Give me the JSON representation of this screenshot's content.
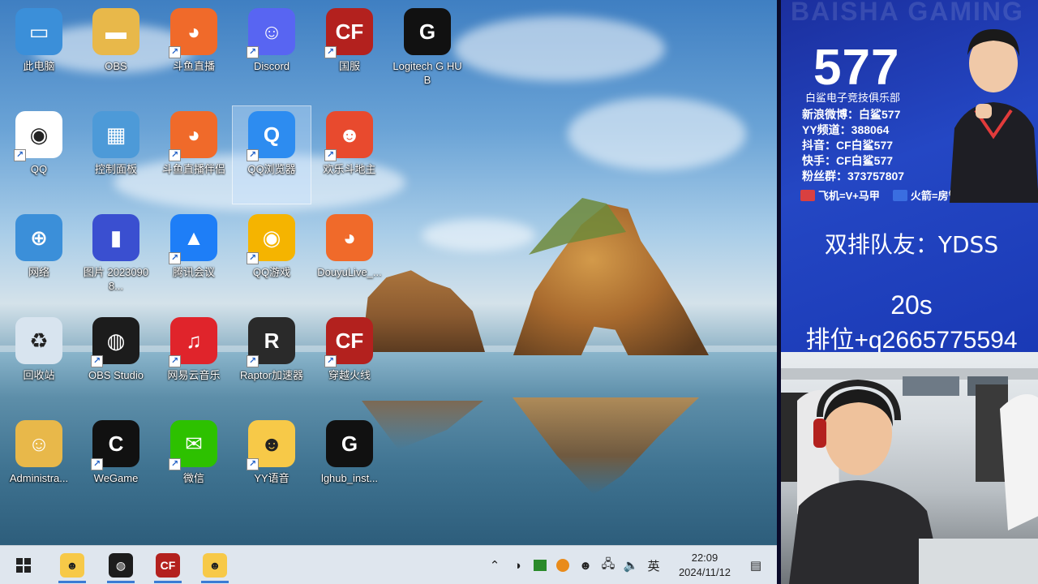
{
  "desktop": {
    "icons": [
      {
        "label": "此电脑",
        "icon": "computer-icon",
        "color": "#3b8fd9",
        "glyph": "▭",
        "shortcut": false
      },
      {
        "label": "OBS",
        "icon": "folder-icon",
        "color": "#e8b84a",
        "glyph": "▬",
        "shortcut": false
      },
      {
        "label": "斗鱼直播",
        "icon": "douyu-icon",
        "color": "#f06a2a",
        "glyph": "◕",
        "shortcut": true
      },
      {
        "label": "Discord",
        "icon": "discord-icon",
        "color": "#5865f2",
        "glyph": "☺",
        "shortcut": true
      },
      {
        "label": "国服",
        "icon": "crossfire-icon",
        "color": "#b3211e",
        "glyph": "CF",
        "shortcut": true
      },
      {
        "label": "Logitech G HUB",
        "icon": "logitech-icon",
        "color": "#111111",
        "glyph": "G",
        "shortcut": false
      },
      {
        "label": "QQ",
        "icon": "qq-icon",
        "color": "#ffffff",
        "glyph": "◉",
        "shortcut": true
      },
      {
        "label": "控制面板",
        "icon": "control-panel-icon",
        "color": "#4d9ad8",
        "glyph": "▦",
        "shortcut": false
      },
      {
        "label": "斗鱼直播伴侣",
        "icon": "douyu-companion-icon",
        "color": "#f06a2a",
        "glyph": "◕",
        "shortcut": true
      },
      {
        "label": "QQ浏览器",
        "icon": "qq-browser-icon",
        "color": "#2d8cf0",
        "glyph": "Q",
        "shortcut": true
      },
      {
        "label": "欢乐斗地主",
        "icon": "landlord-game-icon",
        "color": "#e84a2e",
        "glyph": "☻",
        "shortcut": true
      },
      {
        "label": "网络",
        "icon": "network-icon",
        "color": "#3b8fd9",
        "glyph": "⊕",
        "shortcut": false
      },
      {
        "label": "图片 20230908...",
        "icon": "image-file-icon",
        "color": "#3a4fd0",
        "glyph": "▮",
        "shortcut": false
      },
      {
        "label": "腾讯会议",
        "icon": "tencent-meeting-icon",
        "color": "#1e7ef7",
        "glyph": "▲",
        "shortcut": true
      },
      {
        "label": "QQ游戏",
        "icon": "qq-game-icon",
        "color": "#f5b400",
        "glyph": "◉",
        "shortcut": true
      },
      {
        "label": "DouyuLive_...",
        "icon": "douyu-installer-icon",
        "color": "#f06a2a",
        "glyph": "◕",
        "shortcut": false
      },
      {
        "label": "回收站",
        "icon": "recycle-bin-icon",
        "color": "#d8e4ef",
        "glyph": "♻",
        "shortcut": false
      },
      {
        "label": "OBS Studio",
        "icon": "obs-icon",
        "color": "#1c1c1c",
        "glyph": "◍",
        "shortcut": true
      },
      {
        "label": "网易云音乐",
        "icon": "netease-music-icon",
        "color": "#e0242b",
        "glyph": "♫",
        "shortcut": true
      },
      {
        "label": "Raptor加速器",
        "icon": "raptor-icon",
        "color": "#2a2a2a",
        "glyph": "R",
        "shortcut": true
      },
      {
        "label": "穿越火线",
        "icon": "crossfire-icon",
        "color": "#b3211e",
        "glyph": "CF",
        "shortcut": true
      },
      {
        "label": "Administra...",
        "icon": "user-folder-icon",
        "color": "#e8b84a",
        "glyph": "☺",
        "shortcut": false
      },
      {
        "label": "WeGame",
        "icon": "wegame-icon",
        "color": "#111111",
        "glyph": "C",
        "shortcut": true
      },
      {
        "label": "微信",
        "icon": "wechat-icon",
        "color": "#2dc100",
        "glyph": "✉",
        "shortcut": true
      },
      {
        "label": "YY语音",
        "icon": "yy-icon",
        "color": "#f7c948",
        "glyph": "☻",
        "shortcut": true
      },
      {
        "label": "lghub_inst...",
        "icon": "logitech-installer-icon",
        "color": "#111111",
        "glyph": "G",
        "shortcut": false
      }
    ]
  },
  "taskbar": {
    "start_label": "Start",
    "apps": [
      {
        "name": "yy-taskbar-icon",
        "glyph": "☻",
        "color": "#f7c948"
      },
      {
        "name": "obs-taskbar-icon",
        "glyph": "◍",
        "color": "#1c1c1c"
      },
      {
        "name": "crossfire-taskbar-icon",
        "glyph": "CF",
        "color": "#b3211e"
      },
      {
        "name": "yy-taskbar-icon-2",
        "glyph": "☻",
        "color": "#f7c948"
      }
    ],
    "tray": {
      "ime": "英",
      "time": "22:09",
      "date": "2024/11/12"
    }
  },
  "panel": {
    "watermark": "BAISHA GAMING",
    "number": "577",
    "club": "白鲨电子竞技俱乐部",
    "info": [
      "新浪微博：白鲨577",
      "YY频道：388064",
      "抖音：CF白鲨577",
      "快手：CF白鲨577",
      "粉丝群：373757807"
    ],
    "weapons": [
      "飞机=V+马甲",
      "火箭=房管"
    ],
    "teammate": "双排队友：YDSS",
    "timer": "20s",
    "rank": "排位+q2665775594"
  }
}
